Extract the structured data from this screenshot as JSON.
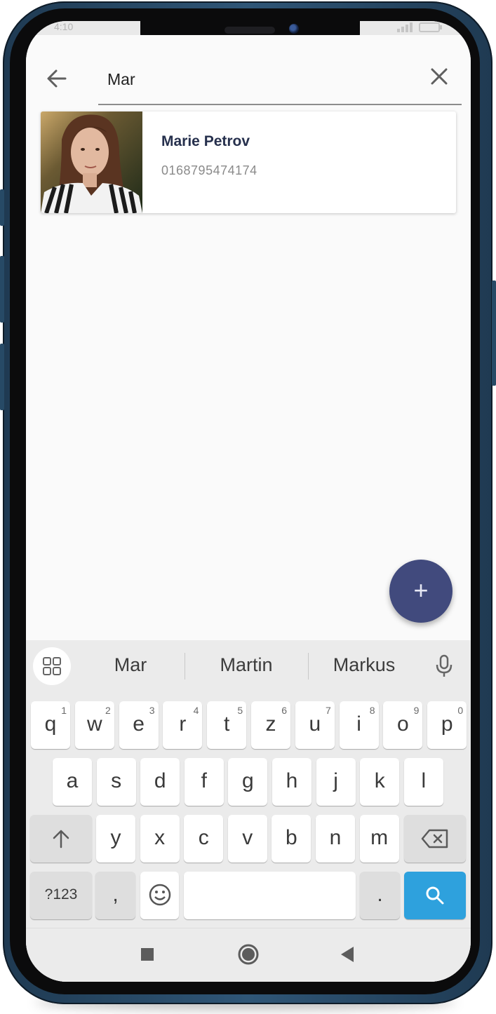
{
  "status_bar": {
    "time": "4:10",
    "icons": [
      "wifi-icon",
      "signal-icon",
      "battery-icon"
    ]
  },
  "search": {
    "query": "Mar",
    "back_icon": "arrow-left-icon",
    "clear_icon": "close-icon"
  },
  "results": [
    {
      "name": "Marie Petrov",
      "phone": "0168795474174"
    }
  ],
  "fab": {
    "label": "+"
  },
  "keyboard": {
    "suggestions": [
      "Mar",
      "Martin",
      "Markus"
    ],
    "row1": [
      {
        "key": "q",
        "hint": "1"
      },
      {
        "key": "w",
        "hint": "2"
      },
      {
        "key": "e",
        "hint": "3"
      },
      {
        "key": "r",
        "hint": "4"
      },
      {
        "key": "t",
        "hint": "5"
      },
      {
        "key": "z",
        "hint": "6"
      },
      {
        "key": "u",
        "hint": "7"
      },
      {
        "key": "i",
        "hint": "8"
      },
      {
        "key": "o",
        "hint": "9"
      },
      {
        "key": "p",
        "hint": "0"
      }
    ],
    "row2": [
      "a",
      "s",
      "d",
      "f",
      "g",
      "h",
      "j",
      "k",
      "l"
    ],
    "row3": [
      "y",
      "x",
      "c",
      "v",
      "b",
      "n",
      "m"
    ],
    "symbols_label": "?123",
    "comma": ",",
    "period": ".",
    "accent_color": "#2ea1dd"
  },
  "colors": {
    "fab": "#414a7d",
    "name_text": "#26304d",
    "phone_frame": "#2f5677"
  }
}
